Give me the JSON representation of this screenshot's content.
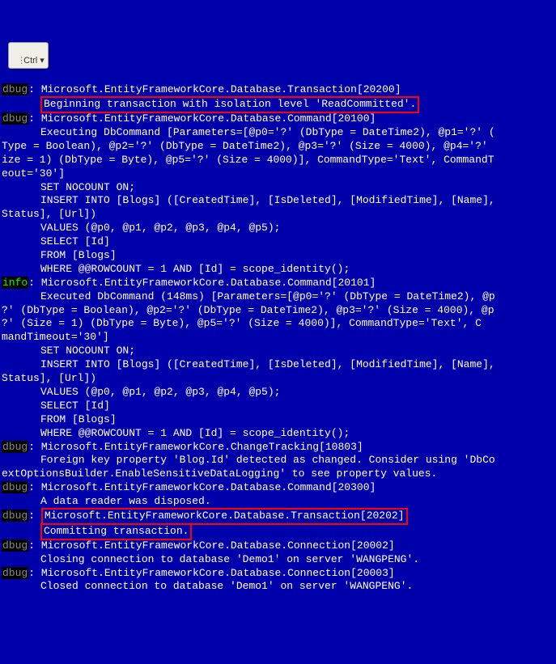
{
  "ctrl_pill": "Ctrl",
  "levels": {
    "dbug": "dbug",
    "info": "info"
  },
  "colon": ": ",
  "lines": [
    {
      "level": "dbug",
      "text": "Microsoft.EntityFrameworkCore.Database.Transaction[20200]"
    },
    {
      "level": "",
      "highlight": true,
      "text": "Beginning transaction with isolation level 'ReadCommitted'."
    },
    {
      "level": "dbug",
      "text": "Microsoft.EntityFrameworkCore.Database.Command[20100]"
    },
    {
      "level": "",
      "indent": true,
      "text": "Executing DbCommand [Parameters=[@p0='?' (DbType = DateTime2), @p1='?' ("
    },
    {
      "level": "",
      "cont": true,
      "text": "Type = Boolean), @p2='?' (DbType = DateTime2), @p3='?' (Size = 4000), @p4='?'"
    },
    {
      "level": "",
      "cont": true,
      "text": "ize = 1) (DbType = Byte), @p5='?' (Size = 4000)], CommandType='Text', CommandT"
    },
    {
      "level": "",
      "cont": true,
      "text": "eout='30']"
    },
    {
      "level": "",
      "indent": true,
      "text": "SET NOCOUNT ON;"
    },
    {
      "level": "",
      "indent": true,
      "text": "INSERT INTO [Blogs] ([CreatedTime], [IsDeleted], [ModifiedTime], [Name], "
    },
    {
      "level": "",
      "cont": true,
      "text": "Status], [Url])"
    },
    {
      "level": "",
      "indent": true,
      "text": "VALUES (@p0, @p1, @p2, @p3, @p4, @p5);"
    },
    {
      "level": "",
      "indent": true,
      "text": "SELECT [Id]"
    },
    {
      "level": "",
      "indent": true,
      "text": "FROM [Blogs]"
    },
    {
      "level": "",
      "indent": true,
      "text": "WHERE @@ROWCOUNT = 1 AND [Id] = scope_identity();"
    },
    {
      "level": "info",
      "text": "Microsoft.EntityFrameworkCore.Database.Command[20101]"
    },
    {
      "level": "",
      "indent": true,
      "text": "Executed DbCommand (148ms) [Parameters=[@p0='?' (DbType = DateTime2), @p"
    },
    {
      "level": "",
      "cont": true,
      "text": "?' (DbType = Boolean), @p2='?' (DbType = DateTime2), @p3='?' (Size = 4000), @p"
    },
    {
      "level": "",
      "cont": true,
      "text": "?' (Size = 1) (DbType = Byte), @p5='?' (Size = 4000)], CommandType='Text', C"
    },
    {
      "level": "",
      "cont": true,
      "text": "mandTimeout='30']"
    },
    {
      "level": "",
      "indent": true,
      "text": "SET NOCOUNT ON;"
    },
    {
      "level": "",
      "indent": true,
      "text": "INSERT INTO [Blogs] ([CreatedTime], [IsDeleted], [ModifiedTime], [Name], "
    },
    {
      "level": "",
      "cont": true,
      "text": "Status], [Url])"
    },
    {
      "level": "",
      "indent": true,
      "text": "VALUES (@p0, @p1, @p2, @p3, @p4, @p5);"
    },
    {
      "level": "",
      "indent": true,
      "text": "SELECT [Id]"
    },
    {
      "level": "",
      "indent": true,
      "text": "FROM [Blogs]"
    },
    {
      "level": "",
      "indent": true,
      "text": "WHERE @@ROWCOUNT = 1 AND [Id] = scope_identity();"
    },
    {
      "level": "dbug",
      "text": "Microsoft.EntityFrameworkCore.ChangeTracking[10803]"
    },
    {
      "level": "",
      "indent": true,
      "text": "Foreign key property 'Blog.Id' detected as changed. Consider using 'DbCo"
    },
    {
      "level": "",
      "cont": true,
      "text": "extOptionsBuilder.EnableSensitiveDataLogging' to see property values."
    },
    {
      "level": "dbug",
      "text": "Microsoft.EntityFrameworkCore.Database.Command[20300]"
    },
    {
      "level": "",
      "indent": true,
      "text": "A data reader was disposed."
    },
    {
      "level": "dbug",
      "highlight": true,
      "text": "Microsoft.EntityFrameworkCore.Database.Transaction[20202]"
    },
    {
      "level": "",
      "highlight": true,
      "text": "Committing transaction."
    },
    {
      "level": "dbug",
      "text": "Microsoft.EntityFrameworkCore.Database.Connection[20002]"
    },
    {
      "level": "",
      "indent": true,
      "text": "Closing connection to database 'Demo1' on server 'WANGPENG'."
    },
    {
      "level": "dbug",
      "text": "Microsoft.EntityFrameworkCore.Database.Connection[20003]"
    },
    {
      "level": "",
      "indent": true,
      "text": "Closed connection to database 'Demo1' on server 'WANGPENG'."
    }
  ]
}
